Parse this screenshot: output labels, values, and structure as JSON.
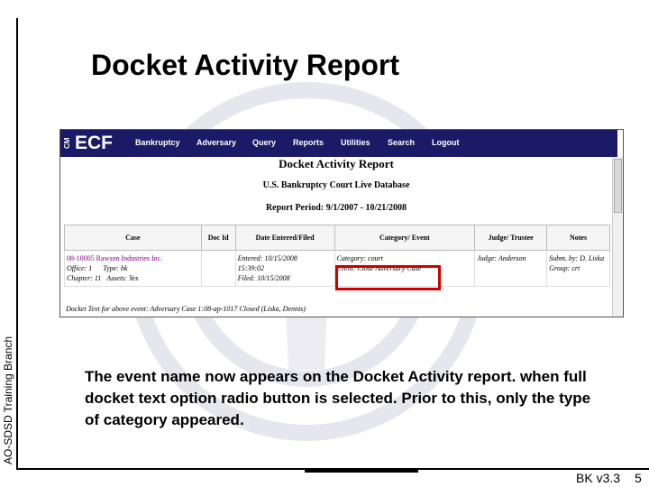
{
  "slide": {
    "side_label": "AO-SDSD Training Branch",
    "title": "Docket Activity Report",
    "description": "The event name now appears on the Docket Activity report. when full docket text option radio button is selected. Prior to this, only the type of category appeared.",
    "version": "BK v3.3",
    "page_number": "5"
  },
  "app": {
    "cm_mark": "CM",
    "logo": "ECF",
    "nav": [
      "Bankruptcy",
      "Adversary",
      "Query",
      "Reports",
      "Utilities",
      "Search",
      "Logout"
    ]
  },
  "report": {
    "title": "Docket Activity Report",
    "court": "U.S. Bankruptcy Court    Live Database",
    "period": "Report Period: 9/1/2007 - 10/21/2008",
    "columns": [
      "Case",
      "Doc Id",
      "Date Entered/Filed",
      "Category/ Event",
      "Judge/ Trustee",
      "Notes"
    ],
    "row": {
      "case_number": "08-10005 Rawson Industries Inc.",
      "case_office": "Office: 1",
      "case_type": "Type: bk",
      "case_chapter": "Chapter: 11",
      "case_assets": "Assets: Yes",
      "doc_id": "",
      "entered": "Entered: 10/15/2008",
      "entered_time": "15:39:02",
      "filed": "Filed: 10/15/2008",
      "category": "Category: court",
      "event": "Event: Close Adversary Case",
      "judge": "Judge: Anderson",
      "notes_submitted": "Subm. by: D. Liska",
      "notes_group": "Group: crt"
    },
    "docket_text": "Docket Text for above event: Adversary Case 1:08-ap-1017 Closed (Liska, Dennis)"
  },
  "colors": {
    "navbar": "#1a1a66",
    "highlight": "#cc0000",
    "case_link": "#800080"
  }
}
